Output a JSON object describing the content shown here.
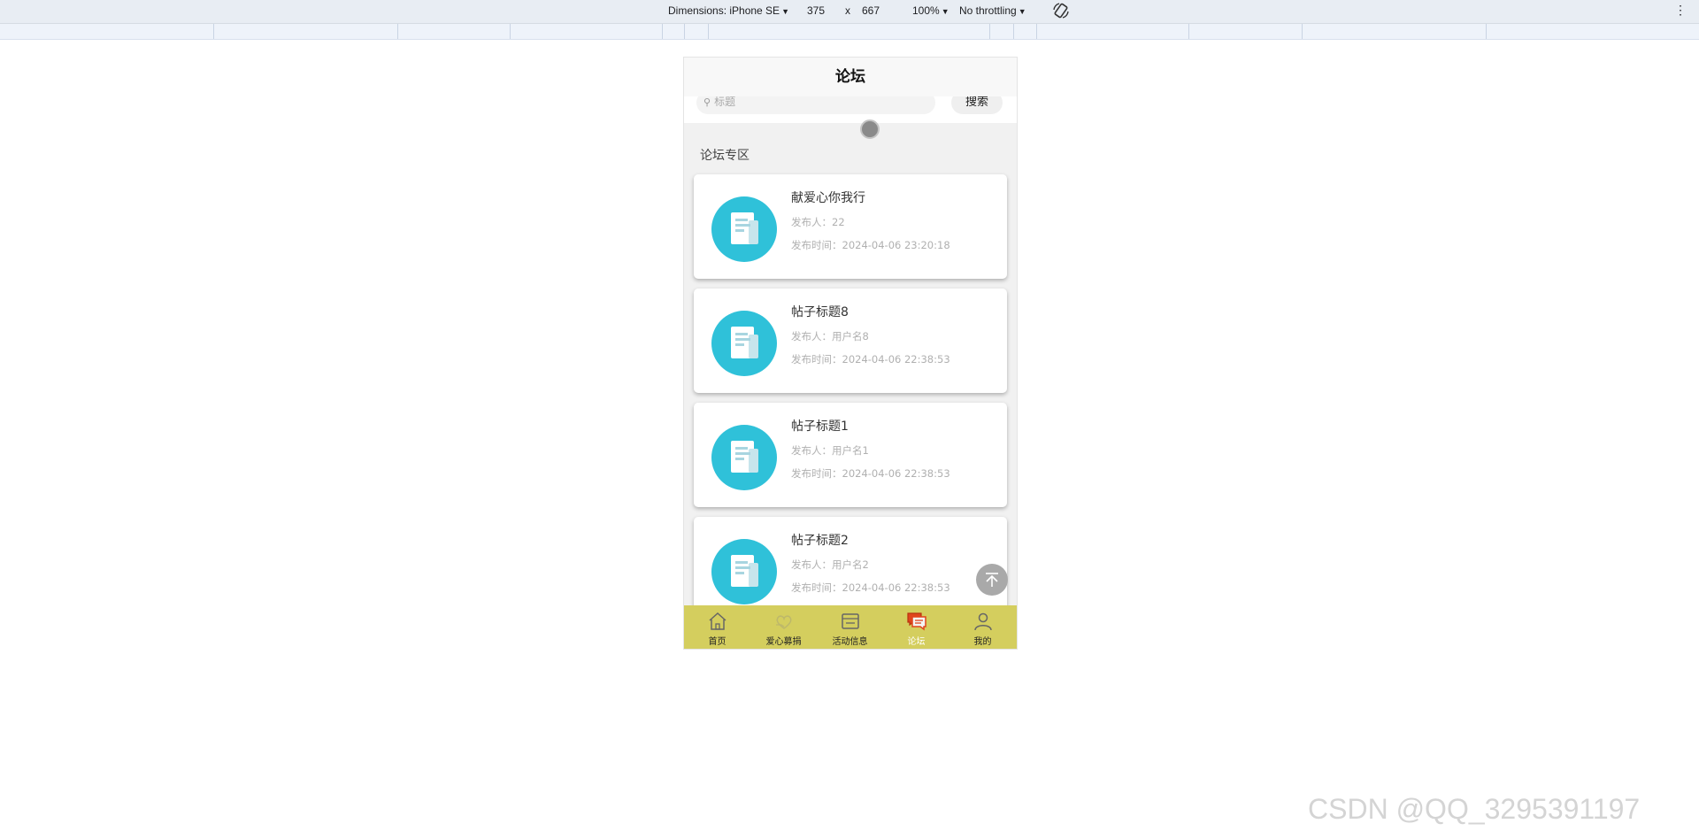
{
  "devtools": {
    "dimensions_label": "Dimensions: iPhone SE",
    "width": "375",
    "times": "x",
    "height": "667",
    "zoom": "100%",
    "throttling": "No throttling"
  },
  "app": {
    "header_title": "论坛",
    "search": {
      "placeholder": "标题",
      "button_label": "搜索"
    },
    "section_title": "论坛专区",
    "posts": [
      {
        "title": "献爱心你我行",
        "poster": "发布人：22",
        "time": "发布时间：2024-04-06 23:20:18"
      },
      {
        "title": "帖子标题8",
        "poster": "发布人：用户名8",
        "time": "发布时间：2024-04-06 22:38:53"
      },
      {
        "title": "帖子标题1",
        "poster": "发布人：用户名1",
        "time": "发布时间：2024-04-06 22:38:53"
      },
      {
        "title": "帖子标题2",
        "poster": "发布人：用户名2",
        "time": "发布时间：2024-04-06 22:38:53"
      }
    ],
    "tabbar": [
      {
        "label": "首页",
        "icon": "home-icon"
      },
      {
        "label": "爱心募捐",
        "icon": "donation-icon"
      },
      {
        "label": "活动信息",
        "icon": "activity-icon"
      },
      {
        "label": "论坛",
        "icon": "forum-icon",
        "active": true
      },
      {
        "label": "我的",
        "icon": "profile-icon"
      }
    ]
  },
  "colors": {
    "tabbar_bg": "#d4ce5e",
    "avatar_bg": "#2fc1d9",
    "active_tab_icon": "#e0451c"
  },
  "watermark": "CSDN @QQ_3295391197"
}
